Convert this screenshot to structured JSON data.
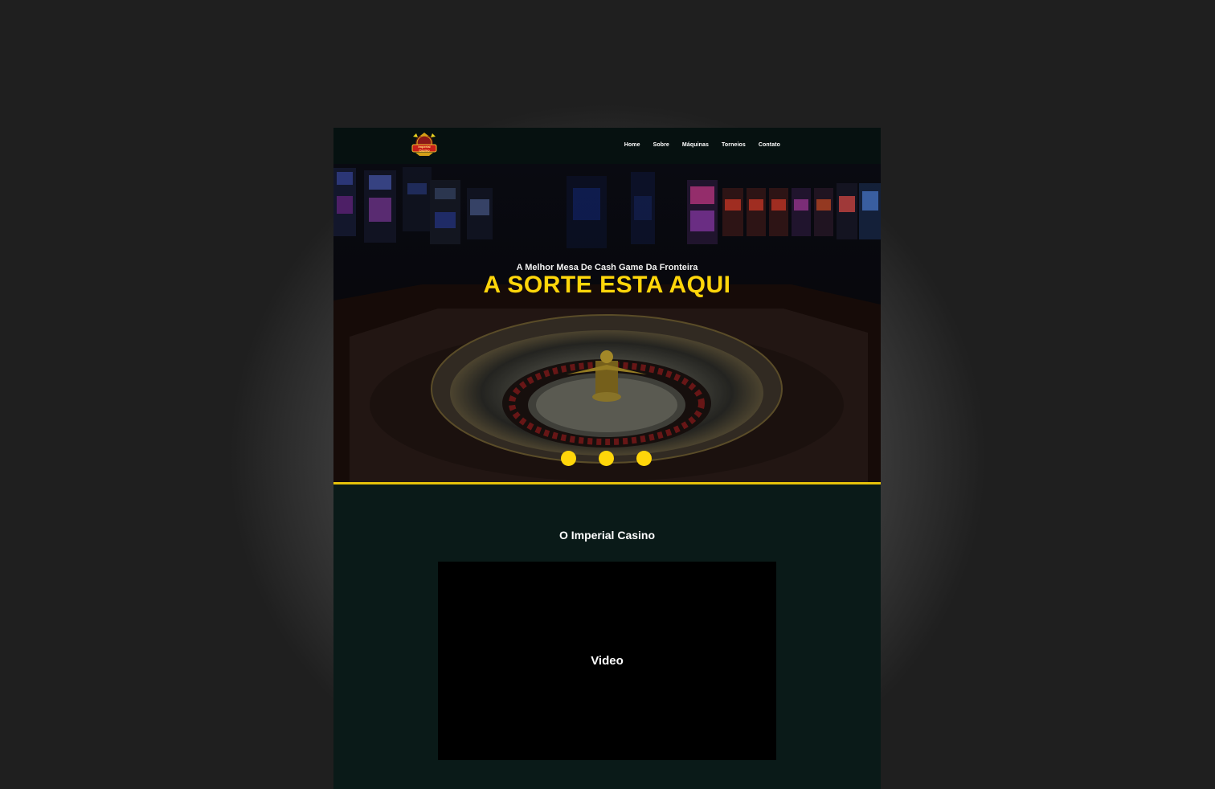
{
  "nav": {
    "logo_text_top": "Imperial",
    "logo_text_bottom": "Casino",
    "links": [
      "Home",
      "Sobre",
      "Máquinas",
      "Torneios",
      "Contato"
    ]
  },
  "hero": {
    "subtitle": "A Melhor Mesa De Cash Game Da Fronteira",
    "title": "A SORTE ESTA AQUI",
    "slides": 3
  },
  "about": {
    "title": "O Imperial Casino",
    "video_label": "Video"
  },
  "colors": {
    "accent": "#ffd60a",
    "navbar_bg": "#061110",
    "section_bg": "#0a1a18"
  }
}
